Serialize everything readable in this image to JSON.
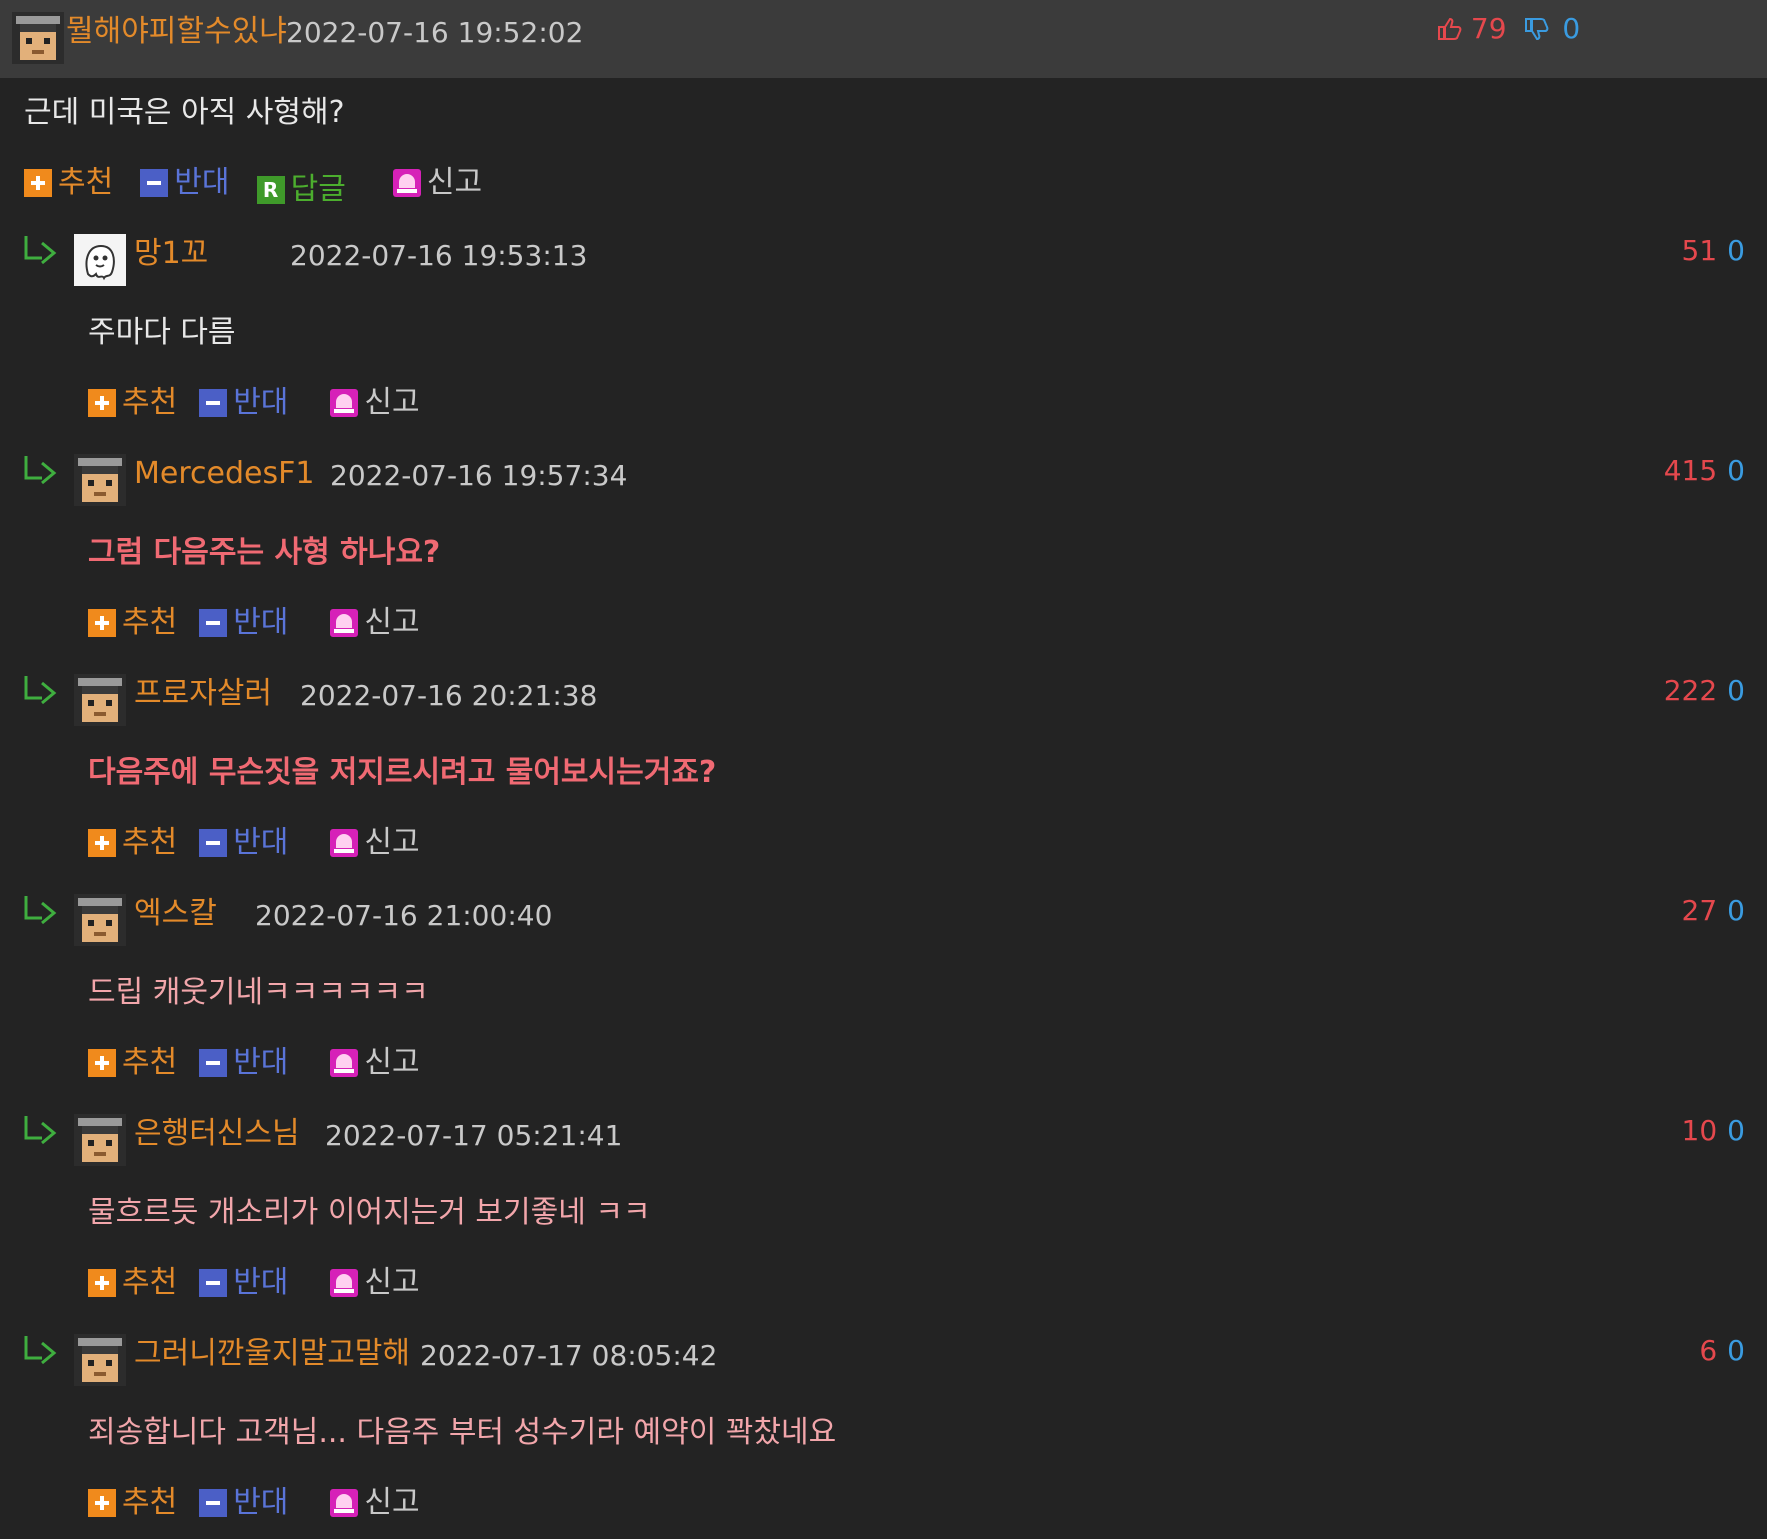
{
  "post": {
    "nickname": "뭘해야피할수있냐",
    "date": "2022-07-16 19:52:02",
    "upvotes": "79",
    "downvotes": "0",
    "text": "근데 미국은 아직 사형해?",
    "actions": {
      "recommend": "추천",
      "oppose": "반대",
      "reply": "답글",
      "report": "신고"
    }
  },
  "replies": [
    {
      "nickname": "망1꼬",
      "date": "2022-07-16 19:53:13",
      "up": "51",
      "down": "0",
      "text": "주마다 다름",
      "avatar": "ghost"
    },
    {
      "nickname": "MercedesF1",
      "date": "2022-07-16 19:57:34",
      "up": "415",
      "down": "0",
      "text": "그럼 다음주는 사형 하나요?",
      "avatar": "default"
    },
    {
      "nickname": "프로자살러",
      "date": "2022-07-16 20:21:38",
      "up": "222",
      "down": "0",
      "text": "다음주에 무슨짓을 저지르시려고 물어보시는거죠?",
      "avatar": "default"
    },
    {
      "nickname": "엑스칼",
      "date": "2022-07-16 21:00:40",
      "up": "27",
      "down": "0",
      "text": "드립 캐웃기네ㅋㅋㅋㅋㅋㅋ",
      "avatar": "default"
    },
    {
      "nickname": "은행터신스님",
      "date": "2022-07-17 05:21:41",
      "up": "10",
      "down": "0",
      "text": "물흐르듯 개소리가 이어지는거 보기좋네 ㅋㅋ",
      "avatar": "default"
    },
    {
      "nickname": "그러니깐울지말고말해",
      "date": "2022-07-17 08:05:42",
      "up": "6",
      "down": "0",
      "text": "죄송합니다 고객님... 다음주 부터 성수기라 예약이 꽉찼네요",
      "avatar": "default"
    }
  ],
  "reply_actions": {
    "recommend": "추천",
    "oppose": "반대",
    "report": "신고"
  },
  "colors": {
    "background": "#232323",
    "header": "#3b3b3b",
    "nickname": "#e38a2a",
    "upvote": "#e5484d",
    "downvote": "#3a9be0"
  },
  "icons": [
    "thumbs-up-icon",
    "thumbs-down-icon",
    "plus-icon",
    "minus-icon",
    "reply-icon",
    "siren-icon",
    "reply-arrow-icon"
  ]
}
